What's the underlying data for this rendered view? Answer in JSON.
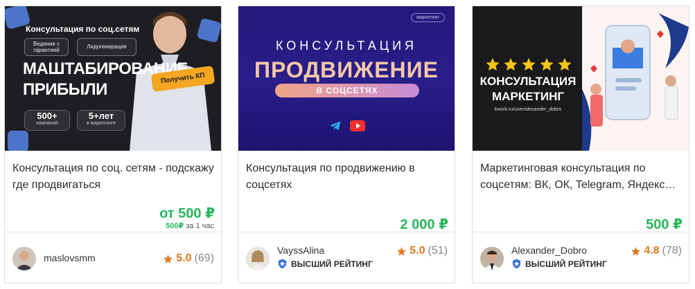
{
  "cards": [
    {
      "title": "Консультация по соц. сетям - подскажу где продвигаться",
      "price": "от 500 ₽",
      "price_sub_value": "500₽",
      "price_sub_unit": "за 1 час",
      "banner": {
        "small_title": "Консультация по соц.сетям",
        "pill_1": "Ведение с гарантией",
        "pill_2": "Лидогенерация",
        "headline_1": "МАШТАБИРОВАНИЕ",
        "headline_2": "ПРИБЫЛИ",
        "stat_1_value": "500+",
        "stat_1_label": "кампаний",
        "stat_2_value": "5+лет",
        "stat_2_label": "в маркетинге",
        "cta": "Получить КП"
      },
      "seller": {
        "name": "maslovsmm",
        "rating": "5.0",
        "count": "(69)"
      }
    },
    {
      "title": "Консультация по продвижению в соцсетях",
      "price": "2 000 ₽",
      "banner": {
        "tag": "маркетинг",
        "line_1": "КОНСУЛЬТАЦИЯ",
        "line_2": "ПРОДВИЖЕНИЕ",
        "line_3": "В СОЦСЕТЯХ"
      },
      "seller": {
        "name": "VayssAlina",
        "badge": "ВЫСШИЙ РЕЙТИНГ",
        "rating": "5.0",
        "count": "(51)"
      }
    },
    {
      "title": "Маркетинговая консультация по соцсетям: ВК, ОК, Telegram, Яндекс…",
      "price": "500 ₽",
      "banner": {
        "headline_1": "КОНСУЛЬТАЦИЯ",
        "headline_2": "МАРКЕТИНГ",
        "url": "kwork.ru/user/alexander_dobro"
      },
      "seller": {
        "name": "Alexander_Dobro",
        "badge": "ВЫСШИЙ РЕЙТИНГ",
        "rating": "4.8",
        "count": "(78)"
      }
    }
  ],
  "colors": {
    "price": "#29b65a",
    "rating": "#e07a1f",
    "badge": "#3a6fd8"
  }
}
